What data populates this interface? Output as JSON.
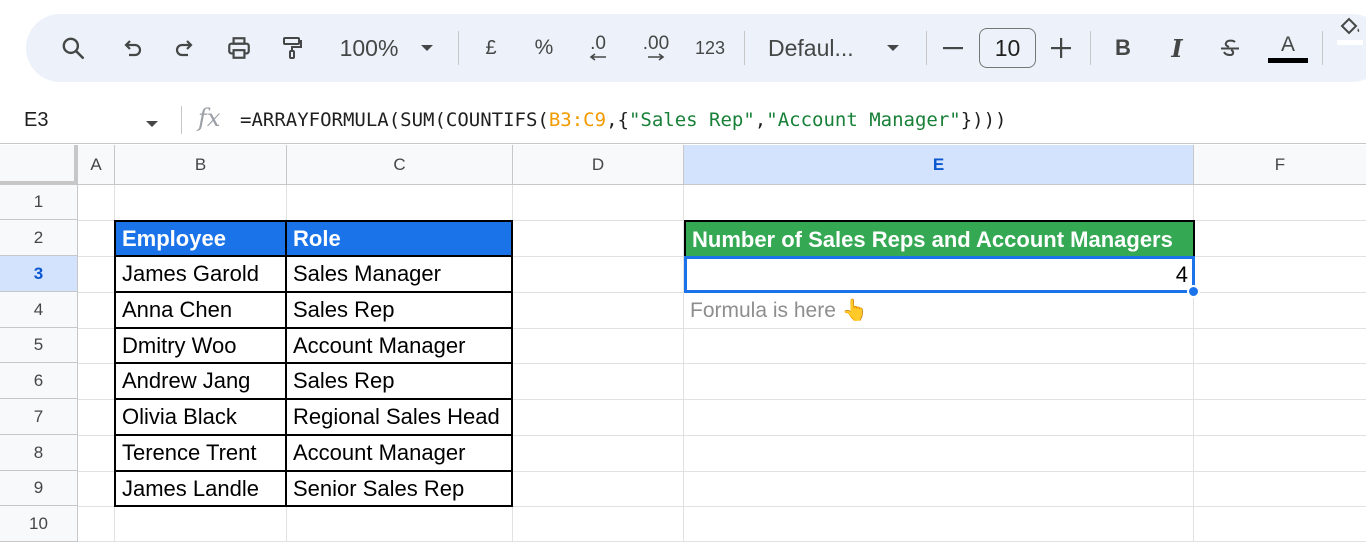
{
  "toolbar": {
    "zoom": "100%",
    "currency": "£",
    "percent": "%",
    "decrease_decimal": ".0",
    "increase_decimal": ".00",
    "number_format": "123",
    "font": "Defaul...",
    "font_size": "10",
    "bold": "B",
    "italic": "I",
    "text_color": "A",
    "text_color_hex": "#000000",
    "icons": [
      "search-icon",
      "undo-icon",
      "redo-icon",
      "print-icon",
      "paint-format-icon",
      "chevron-down-icon",
      "minus-icon",
      "plus-icon",
      "strikethrough-icon",
      "fill-color-icon"
    ]
  },
  "formula_bar": {
    "cell_ref": "E3",
    "fx": "fx",
    "formula_start": "=ARRAYFORMULA(SUM(COUNTIFS(",
    "formula_range": "B3:C9",
    "formula_mid": ",{",
    "formula_str1": "\"Sales Rep\"",
    "formula_comma": ",",
    "formula_str2": "\"Account Manager\"",
    "formula_end": "})))"
  },
  "grid": {
    "columns": [
      "A",
      "B",
      "C",
      "D",
      "E",
      "F"
    ],
    "rows": [
      "1",
      "2",
      "3",
      "4",
      "5",
      "6",
      "7",
      "8",
      "9",
      "10"
    ],
    "active_column": "E",
    "active_row": "3"
  },
  "table": {
    "headers": [
      "Employee",
      "Role"
    ],
    "rows": [
      [
        "James Garold",
        "Sales Manager"
      ],
      [
        "Anna Chen",
        "Sales Rep"
      ],
      [
        "Dmitry Woo",
        "Account Manager"
      ],
      [
        "Andrew Jang",
        "Sales Rep"
      ],
      [
        "Olivia Black",
        "Regional Sales Head"
      ],
      [
        "Terence Trent",
        "Account Manager"
      ],
      [
        "James Landle",
        "Senior Sales Rep"
      ]
    ],
    "header_color": "#1a73e8"
  },
  "result": {
    "header": "Number of Sales Reps and Account Managers",
    "value": "4",
    "note": "Formula is here 👆",
    "header_color": "#34a853"
  }
}
